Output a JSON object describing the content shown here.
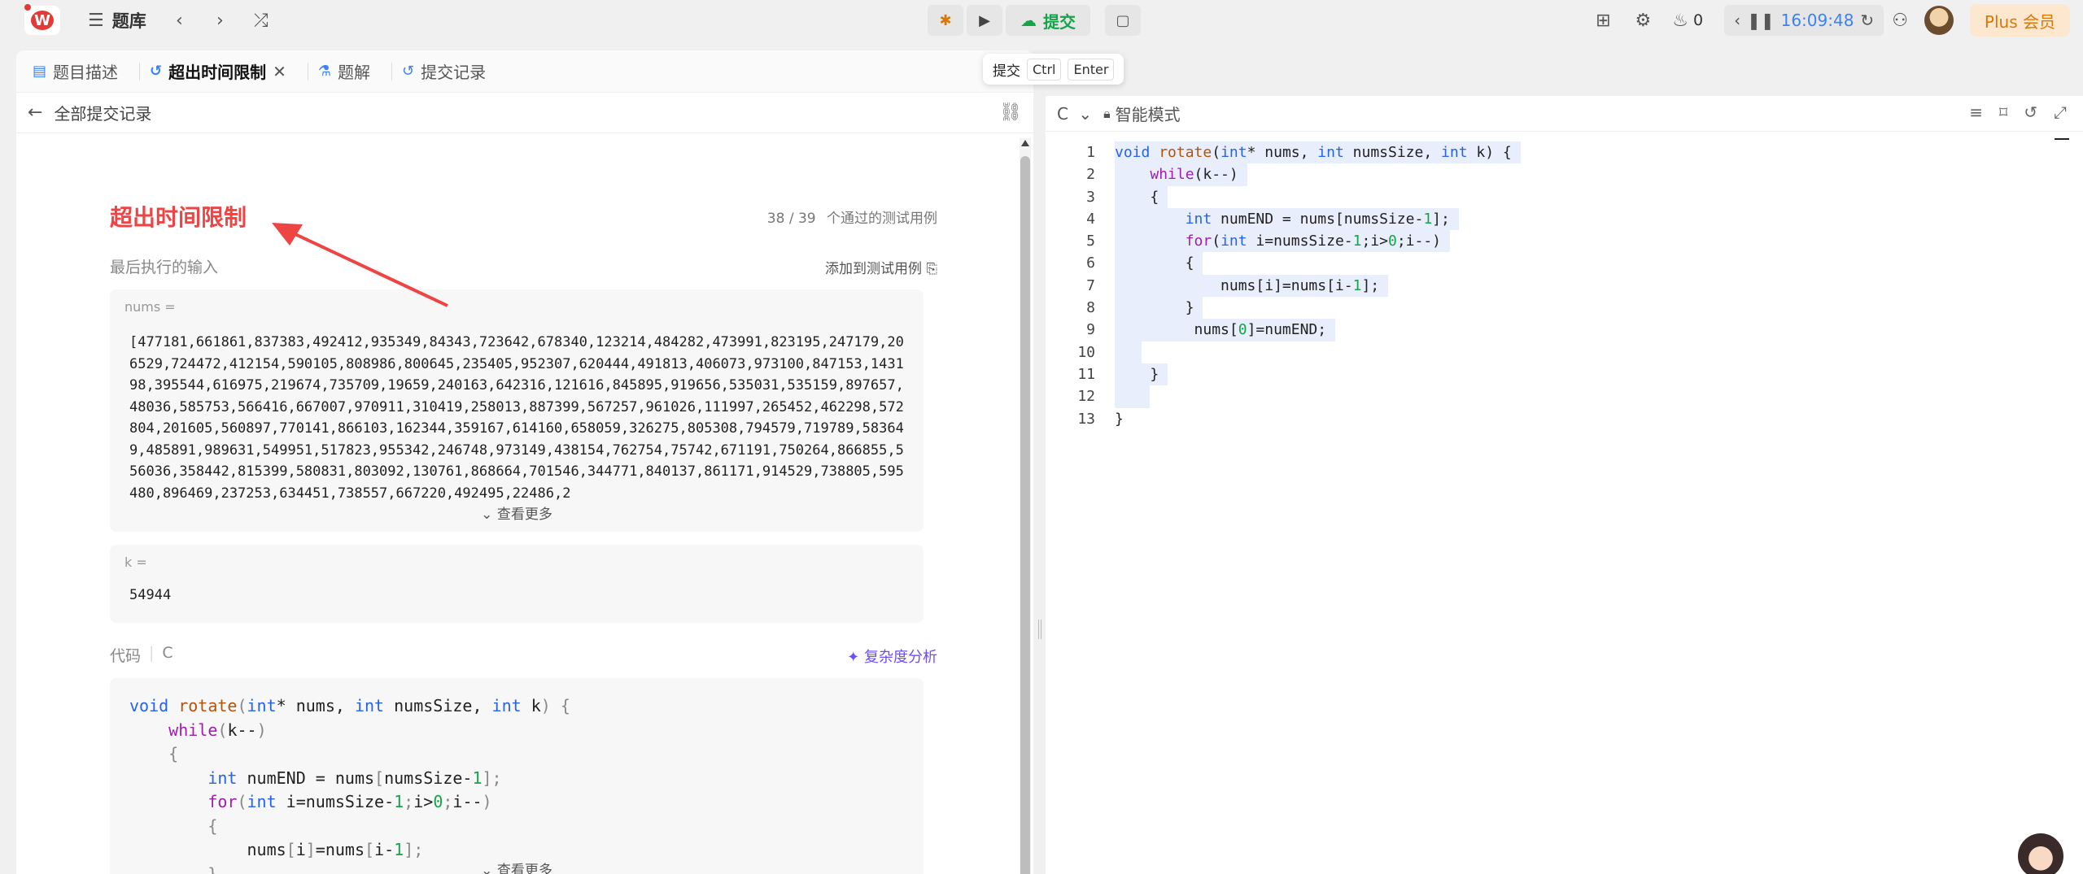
{
  "topbar": {
    "title": "题库",
    "submit_label": "提交",
    "tooltip": {
      "label": "提交",
      "key1": "Ctrl",
      "key2": "Enter"
    },
    "fire_count": "0",
    "timer": "16:09:48",
    "plus_label": "Plus 会员"
  },
  "tabs": [
    {
      "label": "题目描述"
    },
    {
      "label": "超出时间限制"
    },
    {
      "label": "题解"
    },
    {
      "label": "提交记录"
    }
  ],
  "subheader": {
    "back_label": "全部提交记录"
  },
  "result": {
    "status": "超出时间限制",
    "passed": "38 / 39",
    "passed_suffix": "个通过的测试用例",
    "last_input_label": "最后执行的输入",
    "add_test_label": "添加到测试用例",
    "nums_label": "nums =",
    "nums_value": "[477181,661861,837383,492412,935349,84343,723642,678340,123214,484282,473991,823195,247179,206529,724472,412154,590105,808986,800645,235405,952307,620444,491813,406073,973100,847153,143198,395544,616975,219674,735709,19659,240163,642316,121616,845895,919656,535031,535159,897657,48036,585753,566416,667007,970911,310419,258013,887399,567257,961026,111997,265452,462298,572804,201605,560897,770141,866103,162344,359167,614160,658059,326275,805308,794579,719789,583649,485891,989631,549951,517823,955342,246748,973149,438154,762754,75742,671191,750264,866855,556036,358442,815399,580831,803092,130761,868664,701546,344771,840137,861171,914529,738805,595480,896469,237253,634451,738557,667220,492495,22486,2",
    "see_more": "查看更多",
    "k_label": "k =",
    "k_value": "54944",
    "code_label": "代码",
    "code_lang": "C",
    "complexity_label": "复杂度分析",
    "see_more_code": "查看更多"
  },
  "editor": {
    "language": "C",
    "mode": "智能模式",
    "line_numbers": [
      "1",
      "2",
      "3",
      "4",
      "5",
      "6",
      "7",
      "8",
      "9",
      "10",
      "11",
      "12",
      "13"
    ]
  },
  "colors": {
    "error": "#ef4444",
    "accent": "#16a34a",
    "timer": "#3b82f6",
    "link": "#6d4ef2"
  }
}
